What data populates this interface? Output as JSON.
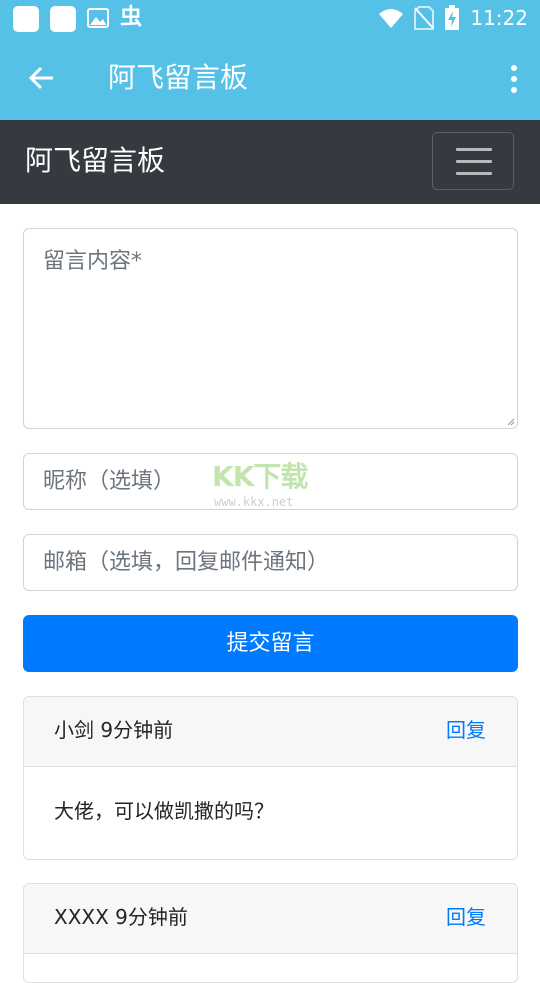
{
  "status_bar": {
    "time": "11:22",
    "icons": [
      "notification-square-icon",
      "notification-square-icon",
      "image-icon",
      "bug-icon",
      "wifi-icon",
      "no-sim-icon",
      "battery-charging-icon"
    ],
    "bug_glyph": "虫"
  },
  "app_bar": {
    "title": "阿飞留言板",
    "back_icon": "arrow-back-icon",
    "more_icon": "more-vert-icon"
  },
  "navbar": {
    "brand": "阿飞留言板",
    "toggler_icon": "hamburger-menu-icon"
  },
  "form": {
    "content_placeholder": "留言内容*",
    "nickname_placeholder": "昵称（选填）",
    "email_placeholder": "邮箱（选填，回复邮件通知）",
    "submit_label": "提交留言"
  },
  "watermark": {
    "text": "KK下载",
    "url": "www.kkx.net"
  },
  "messages": [
    {
      "author": "小剑",
      "time": "9分钟前",
      "reply_label": "回复",
      "content": "大佬，可以做凯撒的吗？"
    },
    {
      "author": "XXXX",
      "time": "9分钟前",
      "reply_label": "回复",
      "content": ""
    }
  ],
  "colors": {
    "app_bar": "#56c1e6",
    "navbar": "#343a40",
    "primary": "#007bff",
    "card_header": "#f7f7f7"
  }
}
